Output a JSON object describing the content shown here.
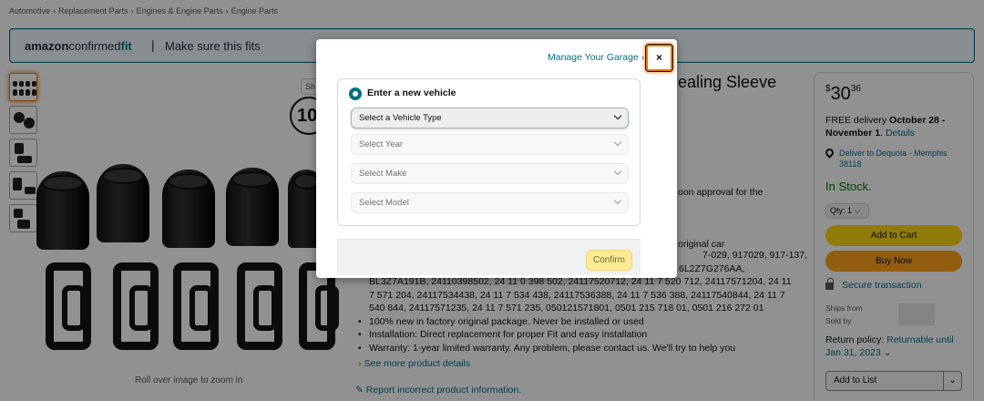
{
  "breadcrumb": [
    "Automotive",
    "Replacement Parts",
    "Engines & Engine Parts",
    "Engine Parts"
  ],
  "breadcrumb_separator": "›",
  "fit_banner": {
    "logo_amazon": "amazon",
    "logo_confirmed": "confirmed",
    "logo_fit": "fit",
    "divider": "|",
    "message": "Make sure this fits"
  },
  "gallery": {
    "zoom_note": "Roll over image to zoom in",
    "badge_count": "10"
  },
  "product": {
    "title_fragment": "ealing Sleeve",
    "approval_fragment": "oon approval for the",
    "original_fragment": "original car",
    "part_numbers": [
      "7-029, 917029, 917-137,",
      "6L2Z7G276AA,",
      "BL3Z7A191B, 24110398502, 24 11 0 398 502, 24117520712, 24 11 7 520 712, 24117571204, 24 11",
      "7 571 204, 24117534438, 24 11 7 534 438, 24117536388, 24 11 7 536 388, 24117540844, 24 11 7",
      "540 844, 24117571235, 24 11 7 571 235, 0501215718​01, 0501 215 718 01, 0501 216 272 01"
    ],
    "bullets": [
      "100% new in factory original package. Never be installed or used",
      "Installation: Direct replacement for proper Fit and easy installation",
      "Warranty: 1-year limited warranty. Any problem, please contact us. We'll try to help you"
    ],
    "see_more": "See more product details",
    "report": "Report incorrect product information."
  },
  "buybox": {
    "currency": "$",
    "price_whole": "30",
    "price_fraction": "36",
    "delivery_prefix": "FREE delivery",
    "delivery_dates": "October 28 - November 1",
    "delivery_link": "Details",
    "deliver_to": "Deliver to Dequoia - Memphis 38118",
    "stock": "In Stock.",
    "qty_label": "Qty: 1",
    "add_to_cart": "Add to Cart",
    "buy_now": "Buy Now",
    "secure": "Secure transaction",
    "ships_from": "Ships from",
    "sold_by": "Sold by",
    "return_label": "Return policy:",
    "return_link": "Returnable until Jan 31, 2023",
    "add_to_list": "Add to List"
  },
  "modal": {
    "garage_link": "Manage Your Garage",
    "close": "×",
    "option_label": "Enter a new vehicle",
    "selects": [
      "Select a Vehicle Type",
      "Select Year",
      "Select Make",
      "Select Model"
    ],
    "confirm": "Confirm"
  },
  "colors": {
    "accent": "#007185",
    "add_to_cart": "#FFD814",
    "buy_now": "#FFA41C",
    "in_stock": "#007600",
    "confirm_disabled": "#FCEB93"
  }
}
